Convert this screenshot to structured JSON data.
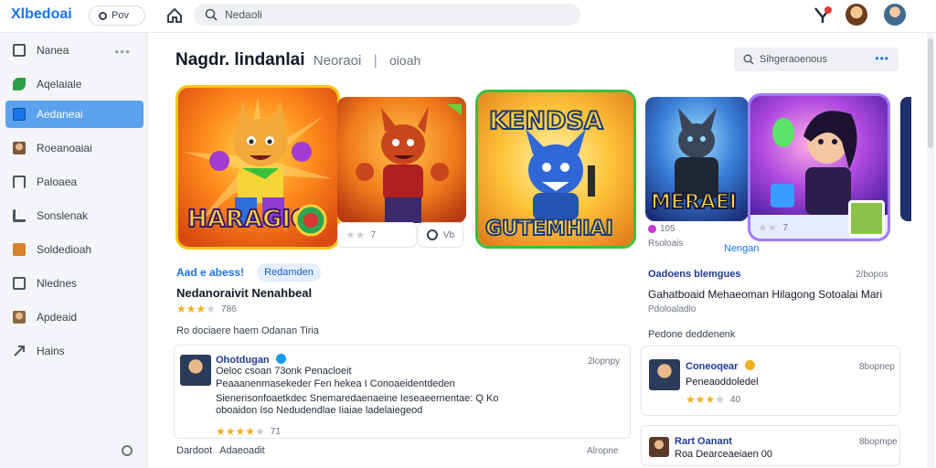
{
  "topbar": {
    "logo": "Xlbedoai",
    "pill_label": "Pov",
    "search_placeholder": "Nedaoli"
  },
  "sidebar": {
    "items": [
      {
        "label": "Nanea",
        "icon": "grid-icon",
        "color": "#4b5563"
      },
      {
        "label": "Aqelaiale",
        "icon": "leaf-icon",
        "color": "#2e9e48"
      },
      {
        "label": "Aedaneai",
        "icon": "folder-icon",
        "color": "#1a73e8"
      },
      {
        "label": "Roeanoaiai",
        "icon": "user-photo-icon",
        "color": "#7a5a3c"
      },
      {
        "label": "Paloaea",
        "icon": "bookmark-icon",
        "color": "#4b5563"
      },
      {
        "label": "Sonslenak",
        "icon": "chart-icon",
        "color": "#4b5563"
      },
      {
        "label": "Soldedioah",
        "icon": "calendar-icon",
        "color": "#d9822b"
      },
      {
        "label": "Nlednes",
        "icon": "news-icon",
        "color": "#4b5563"
      },
      {
        "label": "Apdeaid",
        "icon": "user-photo-icon",
        "color": "#8a6a45"
      },
      {
        "label": "Hains",
        "icon": "share-icon",
        "color": "#4b5563"
      }
    ],
    "active_index": 2
  },
  "main": {
    "title_bold": "Nagdr. lindanlai",
    "title_secondary": "Neoraoi",
    "title_tertiary": "oioah",
    "filter_label": "Sihgeraoenous",
    "cards": [
      {
        "art_text": "HARAGIO",
        "strip_text": "7",
        "strip_action": "Vb"
      },
      {
        "art_text": "KENDSA",
        "art_text_2": "GUTEMHIAI"
      },
      {
        "art_text": "MERAEI",
        "meta_count": "105",
        "meta_text": "Rsoloais",
        "link": "Nengan"
      },
      {
        "strip_text": "7"
      }
    ],
    "left_feature": {
      "link_text": "Aad e abess!",
      "chip": "Redamden",
      "app_name": "Nedanoraivit Nenahbeal",
      "rating_count": "786"
    },
    "right_feature": {
      "heading": "Oadoens blemgues",
      "time": "2/bopos",
      "description": "Gahatboaid Mehaeoman Hilagong Sotoalai Mari",
      "sub": "Pdoloaladlo"
    },
    "reviews_label_left": "Ro dociaere haem Odanan Tiria",
    "reviews_label_right": "Pedone deddenenk",
    "reviews_left": [
      {
        "name": "Ohotdugan",
        "time": "2lopnpy",
        "lines": [
          "Oeloc csoan 73onk Penacloeit",
          "Peaaanenmasekeder Fen hekea  I Conoaeidentdeden",
          "Sienerisonfoaetkdec Snemaredaenaeine Ieseaeernentae: Q  Ko",
          "oboaidon  Iso Nedudendlae  Iiaiae ladelaiegeod"
        ],
        "rating_count": "71"
      },
      {
        "name": "Dardoot",
        "extra": "Adaeoadit",
        "time": "Alropne"
      }
    ],
    "reviews_right": [
      {
        "name": "Coneoqear",
        "time": "8bopnep",
        "line": "Peneaoddoledel",
        "rating_count": "40"
      },
      {
        "name": "Rart Oanant",
        "time": "8bopmpe",
        "line": "Roa Dearceaeiaen 00"
      }
    ]
  }
}
